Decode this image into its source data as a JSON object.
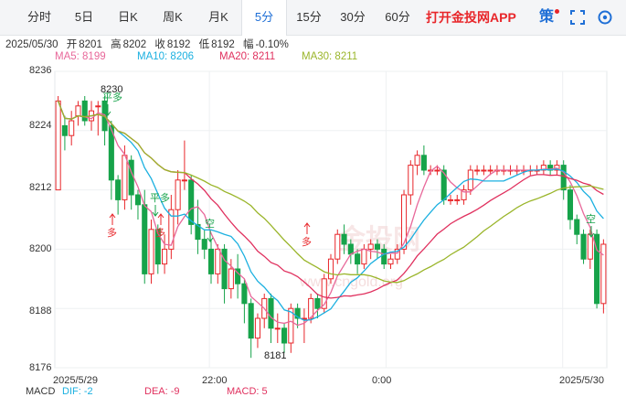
{
  "toolbar": {
    "tabs": [
      {
        "label": "分时",
        "active": false
      },
      {
        "label": "5日",
        "active": false
      },
      {
        "label": "日K",
        "active": false
      },
      {
        "label": "周K",
        "active": false
      },
      {
        "label": "月K",
        "active": false
      },
      {
        "label": "5分",
        "active": true
      },
      {
        "label": "15分",
        "active": false
      },
      {
        "label": "30分",
        "active": false
      },
      {
        "label": "60分",
        "active": false
      }
    ],
    "promo": "打开金投网APP",
    "strategy_icon": "策",
    "icons": [
      "strategy-icon",
      "fullscreen-icon",
      "settings-icon"
    ]
  },
  "info": {
    "date": "2025/05/30",
    "open_label": "开",
    "open": "8201",
    "high_label": "高",
    "high": "8202",
    "close_label": "收",
    "close": "8192",
    "low_label": "低",
    "low": "8192",
    "change_label": "幅",
    "change": "-0.10%"
  },
  "ma": [
    {
      "label": "MA5: 8199",
      "color": "#e8689a"
    },
    {
      "label": "MA10: 8206",
      "color": "#1bb0e0"
    },
    {
      "label": "MA20: 8211",
      "color": "#e0305e"
    },
    {
      "label": "MA30: 8211",
      "color": "#9ab52a"
    }
  ],
  "yaxis": [
    "8236",
    "8224",
    "8212",
    "8200",
    "8188",
    "8176"
  ],
  "xaxis": [
    "2025/5/29",
    "22:00",
    "0:00",
    "2025/5/30"
  ],
  "annotations": {
    "high_mark": "8230",
    "low_mark": "8181",
    "signals": [
      "平多",
      "多",
      "平多",
      "多",
      "空",
      "多",
      "空"
    ]
  },
  "watermark": "www.cngold.org",
  "macd": [
    {
      "label": "MACD",
      "color": "#333333"
    },
    {
      "label": "DIF: -2",
      "color": "#1bb0e0"
    },
    {
      "label": "DEA: -9",
      "color": "#e0305e"
    },
    {
      "label": "MACD: 5",
      "color": "#e0305e"
    }
  ],
  "colors": {
    "up": "#e8262a",
    "down": "#16a34a",
    "accent": "#1f6fd6"
  },
  "chart_data": {
    "type": "candlestick",
    "ylim": [
      8176,
      8236
    ],
    "candles": [
      [
        8212,
        8230,
        8212,
        8231
      ],
      [
        8225,
        8223,
        8220,
        8227
      ],
      [
        8223,
        8226,
        8221,
        8228
      ],
      [
        8227,
        8229,
        8225,
        8230
      ],
      [
        8230,
        8226,
        8225,
        8231
      ],
      [
        8226,
        8228,
        8224,
        8230
      ],
      [
        8229,
        8229,
        8223,
        8230
      ],
      [
        8230,
        8224,
        8221,
        8231
      ],
      [
        8225,
        8214,
        8210,
        8226
      ],
      [
        8214,
        8210,
        8207,
        8215
      ],
      [
        8210,
        8219,
        8208,
        8221
      ],
      [
        8218,
        8211,
        8208,
        8219
      ],
      [
        8211,
        8209,
        8206,
        8212
      ],
      [
        8209,
        8195,
        8193,
        8212
      ],
      [
        8195,
        8204,
        8193,
        8206
      ],
      [
        8204,
        8197,
        8195,
        8205
      ],
      [
        8197,
        8200,
        8195,
        8203
      ],
      [
        8200,
        8208,
        8198,
        8211
      ],
      [
        8208,
        8214,
        8205,
        8216
      ],
      [
        8214,
        8214,
        8212,
        8222
      ],
      [
        8214,
        8205,
        8203,
        8215
      ],
      [
        8205,
        8202,
        8199,
        8210
      ],
      [
        8202,
        8200,
        8198,
        8204
      ],
      [
        8200,
        8195,
        8193,
        8202
      ],
      [
        8195,
        8200,
        8193,
        8201
      ],
      [
        8200,
        8192,
        8189,
        8201
      ],
      [
        8192,
        8196,
        8190,
        8198
      ],
      [
        8196,
        8193,
        8190,
        8199
      ],
      [
        8193,
        8189,
        8185,
        8194
      ],
      [
        8189,
        8182,
        8178,
        8190
      ],
      [
        8182,
        8186,
        8180,
        8187
      ],
      [
        8186,
        8190,
        8184,
        8191
      ],
      [
        8190,
        8184,
        8181,
        8191
      ],
      [
        8184,
        8184,
        8181,
        8187
      ],
      [
        8184,
        8181,
        8179,
        8185
      ],
      [
        8181,
        8188,
        8179,
        8189
      ],
      [
        8188,
        8186,
        8184,
        8189
      ],
      [
        8186,
        8186,
        8181,
        8188
      ],
      [
        8186,
        8190,
        8185,
        8191
      ],
      [
        8190,
        8188,
        8186,
        8191
      ],
      [
        8188,
        8194,
        8187,
        8195
      ],
      [
        8194,
        8198,
        8193,
        8199
      ],
      [
        8198,
        8203,
        8197,
        8204
      ],
      [
        8203,
        8201,
        8199,
        8205
      ],
      [
        8201,
        8199,
        8197,
        8202
      ],
      [
        8199,
        8197,
        8195,
        8200
      ],
      [
        8197,
        8200,
        8196,
        8201
      ],
      [
        8200,
        8201,
        8198,
        8202
      ],
      [
        8201,
        8200,
        8198,
        8202
      ],
      [
        8200,
        8197,
        8196,
        8201
      ],
      [
        8197,
        8198,
        8196,
        8199
      ],
      [
        8198,
        8200,
        8197,
        8201
      ],
      [
        8200,
        8211,
        8199,
        8212
      ],
      [
        8211,
        8217,
        8209,
        8218
      ],
      [
        8217,
        8219,
        8215,
        8220
      ],
      [
        8219,
        8216,
        8215,
        8221
      ],
      [
        8216,
        8216,
        8215,
        8217
      ],
      [
        8216,
        8216,
        8215,
        8217
      ],
      [
        8216,
        8210,
        8209,
        8217
      ],
      [
        8210,
        8210,
        8209,
        8211
      ],
      [
        8210,
        8210,
        8209,
        8211
      ],
      [
        8210,
        8212,
        8209,
        8213
      ],
      [
        8212,
        8216,
        8211,
        8217
      ],
      [
        8216,
        8216,
        8215,
        8217
      ],
      [
        8216,
        8216,
        8215,
        8217
      ],
      [
        8216,
        8216,
        8215,
        8217
      ],
      [
        8216,
        8216,
        8215,
        8217
      ],
      [
        8216,
        8216,
        8215,
        8217
      ],
      [
        8216,
        8216,
        8215,
        8217
      ],
      [
        8216,
        8216,
        8215,
        8217
      ],
      [
        8216,
        8216,
        8215,
        8217
      ],
      [
        8216,
        8216,
        8215,
        8217
      ],
      [
        8216,
        8216,
        8215,
        8217
      ],
      [
        8216,
        8217,
        8215,
        8218
      ],
      [
        8217,
        8216,
        8215,
        8218
      ],
      [
        8216,
        8217,
        8215,
        8218
      ],
      [
        8217,
        8212,
        8210,
        8218
      ],
      [
        8212,
        8206,
        8204,
        8213
      ],
      [
        8206,
        8203,
        8201,
        8207
      ],
      [
        8203,
        8198,
        8197,
        8204
      ],
      [
        8198,
        8203,
        8196,
        8204
      ],
      [
        8203,
        8189,
        8188,
        8204
      ],
      [
        8189,
        8201,
        8187,
        8202
      ]
    ]
  }
}
